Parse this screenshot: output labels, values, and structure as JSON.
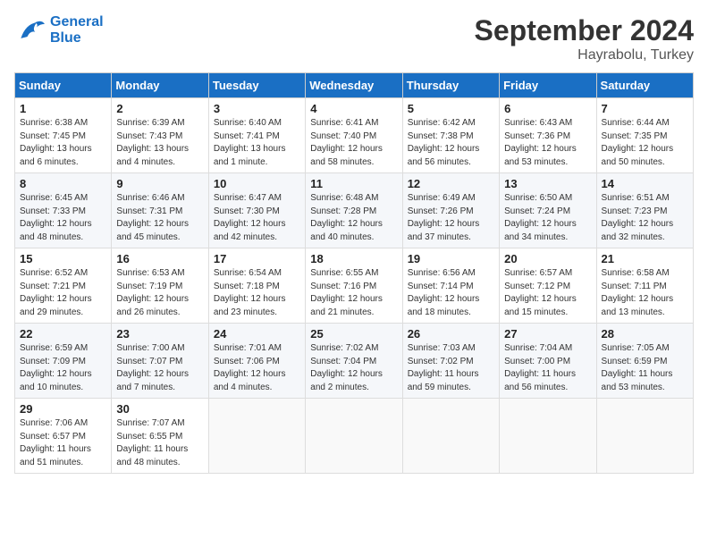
{
  "header": {
    "logo_line1": "General",
    "logo_line2": "Blue",
    "month": "September 2024",
    "location": "Hayrabolu, Turkey"
  },
  "days_of_week": [
    "Sunday",
    "Monday",
    "Tuesday",
    "Wednesday",
    "Thursday",
    "Friday",
    "Saturday"
  ],
  "weeks": [
    [
      {
        "day": 1,
        "sunrise": "6:38 AM",
        "sunset": "7:45 PM",
        "daylight": "13 hours and 6 minutes."
      },
      {
        "day": 2,
        "sunrise": "6:39 AM",
        "sunset": "7:43 PM",
        "daylight": "13 hours and 4 minutes."
      },
      {
        "day": 3,
        "sunrise": "6:40 AM",
        "sunset": "7:41 PM",
        "daylight": "13 hours and 1 minute."
      },
      {
        "day": 4,
        "sunrise": "6:41 AM",
        "sunset": "7:40 PM",
        "daylight": "12 hours and 58 minutes."
      },
      {
        "day": 5,
        "sunrise": "6:42 AM",
        "sunset": "7:38 PM",
        "daylight": "12 hours and 56 minutes."
      },
      {
        "day": 6,
        "sunrise": "6:43 AM",
        "sunset": "7:36 PM",
        "daylight": "12 hours and 53 minutes."
      },
      {
        "day": 7,
        "sunrise": "6:44 AM",
        "sunset": "7:35 PM",
        "daylight": "12 hours and 50 minutes."
      }
    ],
    [
      {
        "day": 8,
        "sunrise": "6:45 AM",
        "sunset": "7:33 PM",
        "daylight": "12 hours and 48 minutes."
      },
      {
        "day": 9,
        "sunrise": "6:46 AM",
        "sunset": "7:31 PM",
        "daylight": "12 hours and 45 minutes."
      },
      {
        "day": 10,
        "sunrise": "6:47 AM",
        "sunset": "7:30 PM",
        "daylight": "12 hours and 42 minutes."
      },
      {
        "day": 11,
        "sunrise": "6:48 AM",
        "sunset": "7:28 PM",
        "daylight": "12 hours and 40 minutes."
      },
      {
        "day": 12,
        "sunrise": "6:49 AM",
        "sunset": "7:26 PM",
        "daylight": "12 hours and 37 minutes."
      },
      {
        "day": 13,
        "sunrise": "6:50 AM",
        "sunset": "7:24 PM",
        "daylight": "12 hours and 34 minutes."
      },
      {
        "day": 14,
        "sunrise": "6:51 AM",
        "sunset": "7:23 PM",
        "daylight": "12 hours and 32 minutes."
      }
    ],
    [
      {
        "day": 15,
        "sunrise": "6:52 AM",
        "sunset": "7:21 PM",
        "daylight": "12 hours and 29 minutes."
      },
      {
        "day": 16,
        "sunrise": "6:53 AM",
        "sunset": "7:19 PM",
        "daylight": "12 hours and 26 minutes."
      },
      {
        "day": 17,
        "sunrise": "6:54 AM",
        "sunset": "7:18 PM",
        "daylight": "12 hours and 23 minutes."
      },
      {
        "day": 18,
        "sunrise": "6:55 AM",
        "sunset": "7:16 PM",
        "daylight": "12 hours and 21 minutes."
      },
      {
        "day": 19,
        "sunrise": "6:56 AM",
        "sunset": "7:14 PM",
        "daylight": "12 hours and 18 minutes."
      },
      {
        "day": 20,
        "sunrise": "6:57 AM",
        "sunset": "7:12 PM",
        "daylight": "12 hours and 15 minutes."
      },
      {
        "day": 21,
        "sunrise": "6:58 AM",
        "sunset": "7:11 PM",
        "daylight": "12 hours and 13 minutes."
      }
    ],
    [
      {
        "day": 22,
        "sunrise": "6:59 AM",
        "sunset": "7:09 PM",
        "daylight": "12 hours and 10 minutes."
      },
      {
        "day": 23,
        "sunrise": "7:00 AM",
        "sunset": "7:07 PM",
        "daylight": "12 hours and 7 minutes."
      },
      {
        "day": 24,
        "sunrise": "7:01 AM",
        "sunset": "7:06 PM",
        "daylight": "12 hours and 4 minutes."
      },
      {
        "day": 25,
        "sunrise": "7:02 AM",
        "sunset": "7:04 PM",
        "daylight": "12 hours and 2 minutes."
      },
      {
        "day": 26,
        "sunrise": "7:03 AM",
        "sunset": "7:02 PM",
        "daylight": "11 hours and 59 minutes."
      },
      {
        "day": 27,
        "sunrise": "7:04 AM",
        "sunset": "7:00 PM",
        "daylight": "11 hours and 56 minutes."
      },
      {
        "day": 28,
        "sunrise": "7:05 AM",
        "sunset": "6:59 PM",
        "daylight": "11 hours and 53 minutes."
      }
    ],
    [
      {
        "day": 29,
        "sunrise": "7:06 AM",
        "sunset": "6:57 PM",
        "daylight": "11 hours and 51 minutes."
      },
      {
        "day": 30,
        "sunrise": "7:07 AM",
        "sunset": "6:55 PM",
        "daylight": "11 hours and 48 minutes."
      },
      null,
      null,
      null,
      null,
      null
    ]
  ]
}
